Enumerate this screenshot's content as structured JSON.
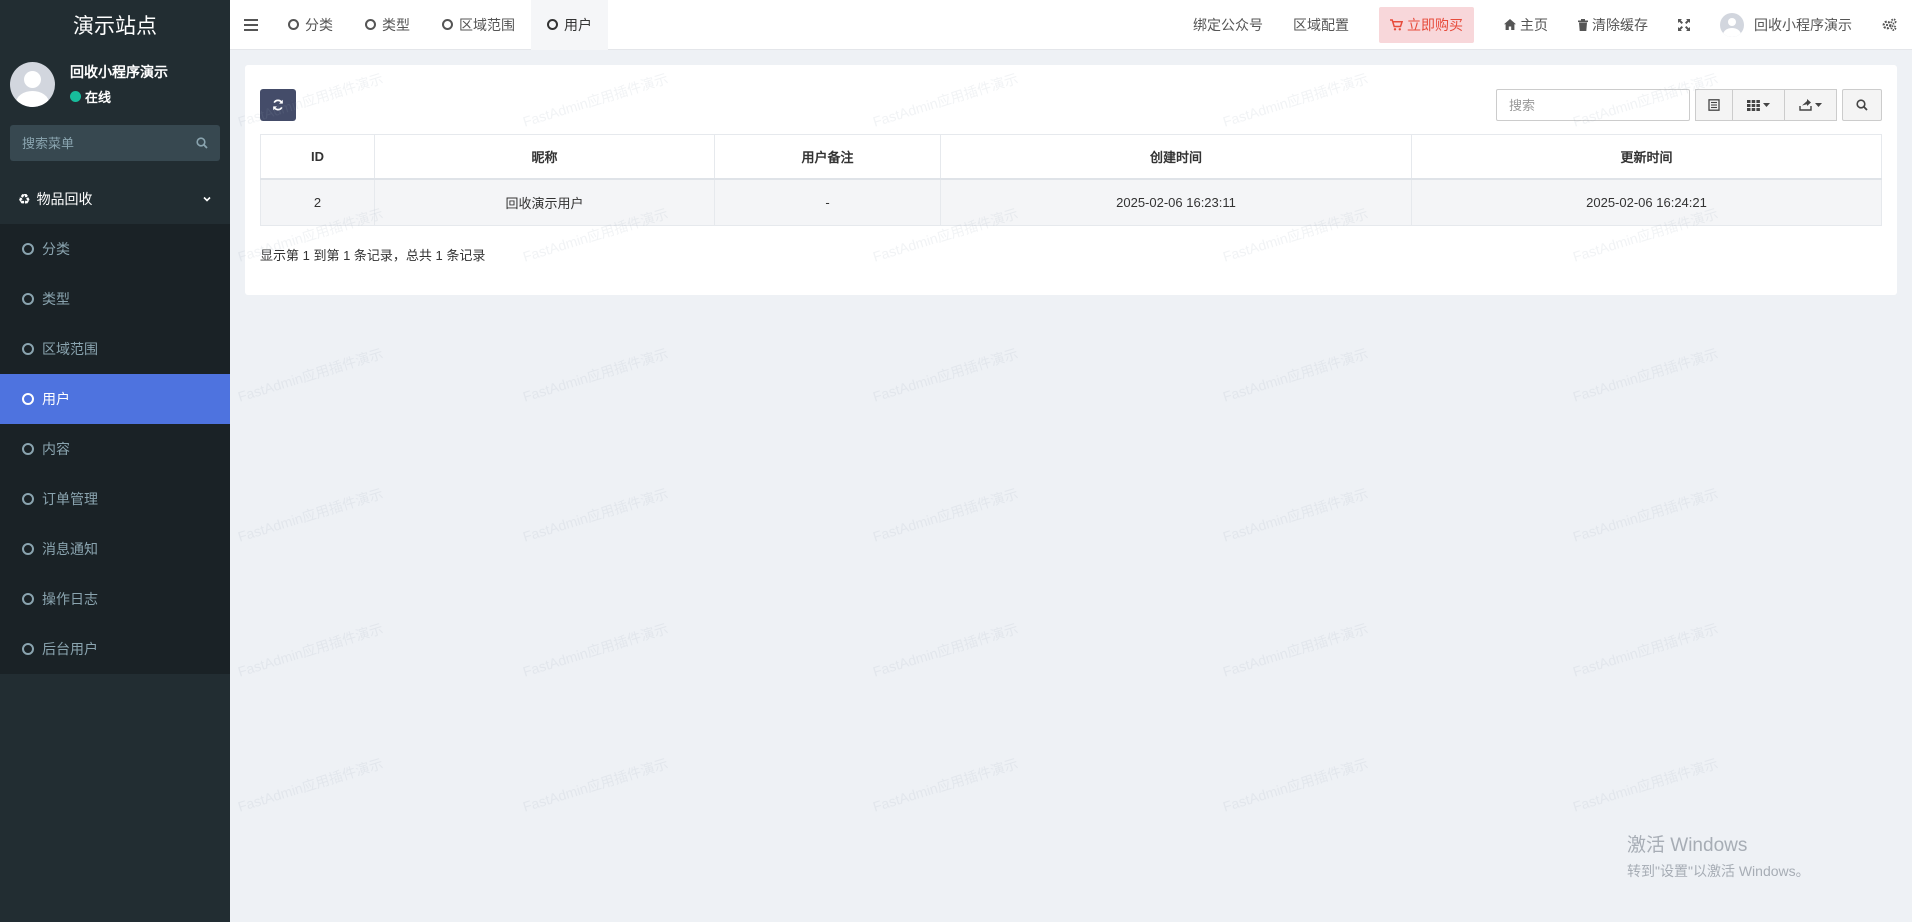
{
  "sidebar": {
    "brand": "演示站点",
    "user": {
      "name": "回收小程序演示",
      "status": "在线"
    },
    "search_placeholder": "搜索菜单",
    "group_label": "物品回收",
    "items": [
      {
        "label": "分类"
      },
      {
        "label": "类型"
      },
      {
        "label": "区域范围"
      },
      {
        "label": "用户"
      },
      {
        "label": "内容"
      },
      {
        "label": "订单管理"
      },
      {
        "label": "消息通知"
      },
      {
        "label": "操作日志"
      },
      {
        "label": "后台用户"
      }
    ]
  },
  "navbar": {
    "tabs": [
      {
        "label": "分类"
      },
      {
        "label": "类型"
      },
      {
        "label": "区域范围"
      },
      {
        "label": "用户"
      }
    ],
    "links": {
      "bind_account": "绑定公众号",
      "region_config": "区域配置",
      "buy_now": "立即购买",
      "home": "主页",
      "clear_cache": "清除缓存",
      "username": "回收小程序演示"
    }
  },
  "toolbar": {
    "search_placeholder": "搜索"
  },
  "table": {
    "columns": [
      "ID",
      "昵称",
      "用户备注",
      "创建时间",
      "更新时间"
    ],
    "rows": [
      [
        "2",
        "回收演示用户",
        "-",
        "2025-02-06 16:23:11",
        "2025-02-06 16:24:21"
      ]
    ],
    "pagination": "显示第 1 到第 1 条记录，总共 1 条记录"
  },
  "watermark": "FastAdmin应用插件演示",
  "windows_activation": {
    "title": "激活 Windows",
    "subtitle": "转到\"设置\"以激活 Windows。"
  },
  "colors": {
    "sidebar_bg": "#222d32",
    "active_menu": "#4e73df",
    "online": "#18bc9c",
    "buy_bg": "#f8d7da",
    "buy_text": "#e74c3c",
    "refresh_btn": "#444c69"
  }
}
